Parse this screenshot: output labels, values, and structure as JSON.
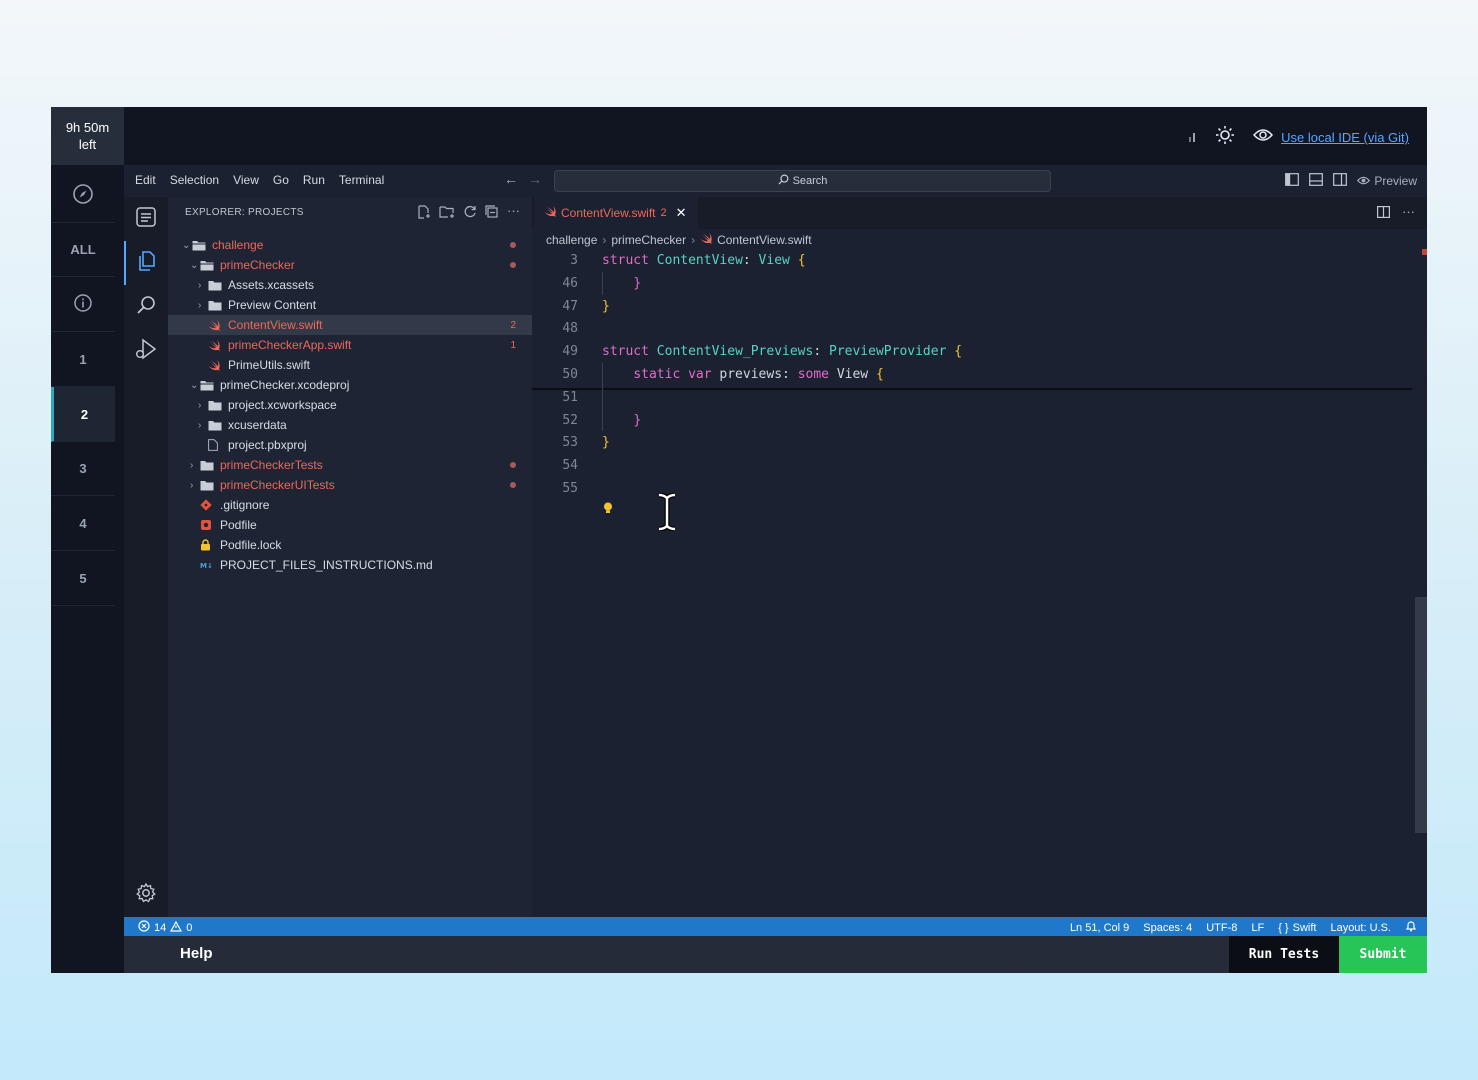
{
  "timer": {
    "line1": "9h 50m",
    "line2": "left"
  },
  "rail": {
    "items": [
      "ALL",
      "1",
      "2",
      "3",
      "4",
      "5"
    ],
    "active": "2"
  },
  "header": {
    "ide_link": "Use local IDE (via Git)"
  },
  "menu": {
    "items": [
      "Edit",
      "Selection",
      "View",
      "Go",
      "Run",
      "Terminal"
    ],
    "search": "Search",
    "preview": "Preview"
  },
  "explorer": {
    "title": "EXPLORER: PROJECTS",
    "rows": [
      {
        "label": "challenge",
        "indent": 0,
        "type": "folder-open",
        "color": "red",
        "dot": true
      },
      {
        "label": "primeChecker",
        "indent": 1,
        "type": "folder-open",
        "color": "red",
        "dot": true
      },
      {
        "label": "Assets.xcassets",
        "indent": 2,
        "type": "folder",
        "color": "white"
      },
      {
        "label": "Preview Content",
        "indent": 2,
        "type": "folder",
        "color": "white"
      },
      {
        "label": "ContentView.swift",
        "indent": 2,
        "type": "swift",
        "color": "red",
        "badge": "2",
        "selected": true
      },
      {
        "label": "primeCheckerApp.swift",
        "indent": 2,
        "type": "swift",
        "color": "red",
        "badge": "1"
      },
      {
        "label": "PrimeUtils.swift",
        "indent": 2,
        "type": "swift",
        "color": "white"
      },
      {
        "label": "primeChecker.xcodeproj",
        "indent": 1,
        "type": "folder-open",
        "color": "white"
      },
      {
        "label": "project.xcworkspace",
        "indent": 2,
        "type": "folder",
        "color": "white"
      },
      {
        "label": "xcuserdata",
        "indent": 2,
        "type": "folder",
        "color": "white"
      },
      {
        "label": "project.pbxproj",
        "indent": 2,
        "type": "file",
        "color": "white"
      },
      {
        "label": "primeCheckerTests",
        "indent": 1,
        "type": "folder",
        "color": "red",
        "dot": true
      },
      {
        "label": "primeCheckerUITests",
        "indent": 1,
        "type": "folder",
        "color": "red",
        "dot": true
      },
      {
        "label": ".gitignore",
        "indent": 1,
        "type": "git",
        "color": "white"
      },
      {
        "label": "Podfile",
        "indent": 1,
        "type": "pod",
        "color": "white"
      },
      {
        "label": "Podfile.lock",
        "indent": 1,
        "type": "lock",
        "color": "white"
      },
      {
        "label": "PROJECT_FILES_INSTRUCTIONS.md",
        "indent": 1,
        "type": "md",
        "color": "white"
      }
    ]
  },
  "editor": {
    "tab": {
      "label": "ContentView.swift",
      "badge": "2"
    },
    "breadcrumb": [
      "challenge",
      "primeChecker",
      "ContentView.swift"
    ],
    "lines": [
      {
        "n": "3",
        "tokens": [
          [
            "kw",
            "struct "
          ],
          [
            "ty",
            "ContentView"
          ],
          [
            "tx",
            ": "
          ],
          [
            "ty",
            "View "
          ],
          [
            "br",
            "{"
          ]
        ]
      },
      {
        "n": "46",
        "tokens": [
          [
            "tx",
            "    "
          ],
          [
            "kw",
            "}"
          ]
        ]
      },
      {
        "n": "47",
        "tokens": [
          [
            "br",
            "}"
          ]
        ]
      },
      {
        "n": "48",
        "tokens": []
      },
      {
        "n": "49",
        "tokens": [
          [
            "kw",
            "struct "
          ],
          [
            "ty",
            "ContentView_Previews"
          ],
          [
            "tx",
            ": "
          ],
          [
            "ty",
            "PreviewProvider "
          ],
          [
            "br",
            "{"
          ]
        ]
      },
      {
        "n": "50",
        "tokens": [
          [
            "tx",
            "    "
          ],
          [
            "kw",
            "static var "
          ],
          [
            "tx",
            "previews: "
          ],
          [
            "kw",
            "some "
          ],
          [
            "tx",
            "View "
          ],
          [
            "br",
            "{"
          ]
        ]
      },
      {
        "n": "51",
        "tokens": []
      },
      {
        "n": "52",
        "tokens": [
          [
            "tx",
            "    "
          ],
          [
            "kw",
            "}"
          ]
        ]
      },
      {
        "n": "53",
        "tokens": [
          [
            "br",
            "}"
          ]
        ]
      },
      {
        "n": "54",
        "tokens": []
      },
      {
        "n": "55",
        "tokens": []
      }
    ]
  },
  "status": {
    "errors": "14",
    "warnings": "0",
    "position": "Ln 51, Col 9",
    "spaces": "Spaces: 4",
    "encoding": "UTF-8",
    "eol": "LF",
    "language": "Swift",
    "layout": "Layout: U.S."
  },
  "bottom": {
    "help": "Help",
    "run_tests": "Run Tests",
    "submit": "Submit"
  }
}
